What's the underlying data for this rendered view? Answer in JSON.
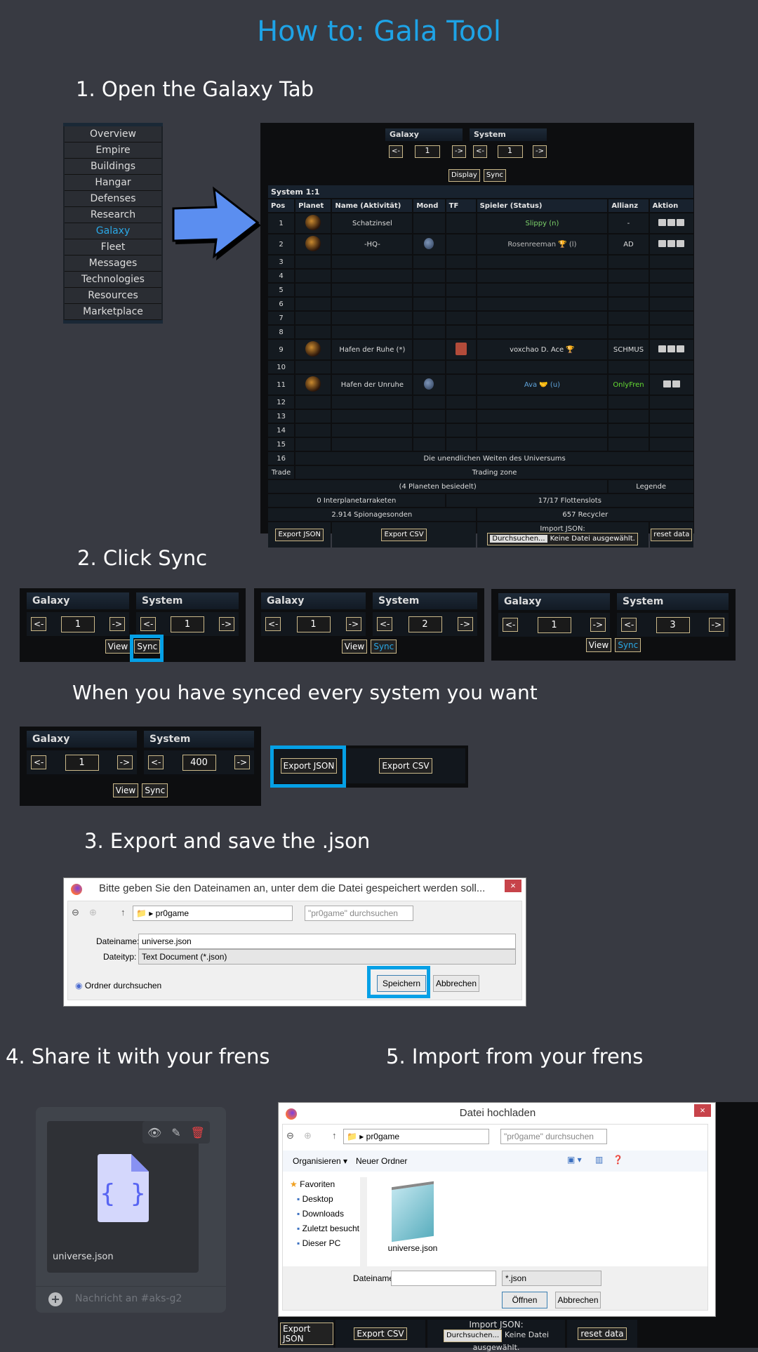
{
  "title": "How to: Gala Tool",
  "steps": {
    "s1": "1. Open the Galaxy Tab",
    "s2": "2. Click Sync",
    "s2b": "When you have synced every system you want",
    "s3": "3. Export and save the .json",
    "s4": "4. Share it with your frens",
    "s5": "5. Import from your frens"
  },
  "colors": {
    "accent": "#1ea3e6",
    "background": "#383a42",
    "highlight": "#05a0e6"
  },
  "menu": [
    "Overview",
    "Empire",
    "Buildings",
    "Hangar",
    "Defenses",
    "Research",
    "Galaxy",
    "Fleet",
    "Messages",
    "Technologies",
    "Resources",
    "Marketplace"
  ],
  "menu_active": "Galaxy",
  "galaxy": {
    "galaxy_label": "Galaxy",
    "system_label": "System",
    "prev": "<-",
    "next": "->",
    "galaxy_value": "1",
    "system_value": "1",
    "display": "Display",
    "sync": "Sync",
    "system_title": "System 1:1",
    "columns": [
      "Pos",
      "Planet",
      "Name (Aktivität)",
      "Mond",
      "TF",
      "Spieler (Status)",
      "Allianz",
      "Aktion"
    ],
    "rows": [
      {
        "pos": "1",
        "planet": true,
        "name": "Schatzinsel",
        "moon": false,
        "tf": false,
        "player": "Slippy (n)",
        "player_color": "#7dd36b",
        "alliance": "-",
        "alliance_color": "#ddd",
        "actions": 3
      },
      {
        "pos": "2",
        "planet": true,
        "name": "-HQ-",
        "moon": true,
        "tf": false,
        "player": "Rosenreeman 🏆 (l)",
        "player_color": "#bbb",
        "alliance": "AD",
        "alliance_color": "#ddd",
        "actions": 3
      },
      {
        "pos": "3"
      },
      {
        "pos": "4"
      },
      {
        "pos": "5"
      },
      {
        "pos": "6"
      },
      {
        "pos": "7"
      },
      {
        "pos": "8"
      },
      {
        "pos": "9",
        "planet": true,
        "name": "Hafen der Ruhe (*)",
        "moon": false,
        "tf": true,
        "player": "voxchao D. Ace 🏆",
        "player_color": "#ddd",
        "alliance": "SCHMUS",
        "alliance_color": "#ddd",
        "actions": 3
      },
      {
        "pos": "10"
      },
      {
        "pos": "11",
        "planet": true,
        "name": "Hafen der Unruhe",
        "moon": true,
        "tf": false,
        "player": "Ava 🤝 (u)",
        "player_color": "#5fa3d9",
        "alliance": "OnlyFren",
        "alliance_color": "#66dd33",
        "actions": 2
      },
      {
        "pos": "12"
      },
      {
        "pos": "13"
      },
      {
        "pos": "14"
      },
      {
        "pos": "15"
      }
    ],
    "row16_pos": "16",
    "row16_text": "Die unendlichen Weiten des Universums",
    "trade_pos": "Trade",
    "trade_text": "Trading zone",
    "settled": "(4 Planeten besiedelt)",
    "legend": "Legende",
    "missiles": "0 Interplanetarraketen",
    "fleetslots": "17/17 Flottenslots",
    "probes": "2.914 Spionagesonden",
    "recyclers": "657 Recycler",
    "export_json": "Export JSON",
    "export_csv": "Export CSV",
    "import_label": "Import JSON:",
    "browse": "Durchsuchen...",
    "no_file": "Keine Datei ausgewählt.",
    "reset": "reset data"
  },
  "sync_panels": [
    {
      "galaxy": "Galaxy",
      "system": "System",
      "prev": "<-",
      "next": "->",
      "g": "1",
      "s": "1",
      "view": "View",
      "sync": "Sync"
    },
    {
      "galaxy": "Galaxy",
      "system": "System",
      "prev": "<-",
      "next": "->",
      "g": "1",
      "s": "2",
      "view": "View",
      "sync": "Sync"
    },
    {
      "galaxy": "Galaxy",
      "system": "System",
      "prev": "<-",
      "next": "->",
      "g": "1",
      "s": "3",
      "view": "View",
      "sync": "Sync"
    },
    {
      "galaxy": "Galaxy",
      "system": "System",
      "prev": "<-",
      "next": "->",
      "g": "1",
      "s": "400",
      "view": "View",
      "sync": "Sync"
    }
  ],
  "export_panel": {
    "json": "Export JSON",
    "csv": "Export CSV"
  },
  "save_dialog": {
    "title": "Bitte geben Sie den Dateinamen an, unter dem die Datei gespeichert werden soll...",
    "close": "×",
    "folder": "pr0game",
    "search_placeholder": "\"pr0game\" durchsuchen",
    "filename_label": "Dateiname:",
    "filename": "universe.json",
    "filetype_label": "Dateityp:",
    "filetype": "Text Document (*.json)",
    "browse_folders": "Ordner durchsuchen",
    "save": "Speichern",
    "cancel": "Abbrechen"
  },
  "discord": {
    "filename": "universe.json",
    "message_placeholder": "Nachricht an #aks-g2"
  },
  "open_dialog": {
    "title": "Datei hochladen",
    "close": "×",
    "folder": "pr0game",
    "search_placeholder": "\"pr0game\" durchsuchen",
    "organize": "Organisieren ▾",
    "new_folder": "Neuer Ordner",
    "favorites": "Favoriten",
    "nav": [
      "Desktop",
      "Downloads",
      "Zuletzt besucht",
      "Dieser PC"
    ],
    "file": "universe.json",
    "filename_label": "Dateiname:",
    "filename": "",
    "filter": "*.json",
    "open": "Öffnen",
    "cancel": "Abbrechen"
  }
}
